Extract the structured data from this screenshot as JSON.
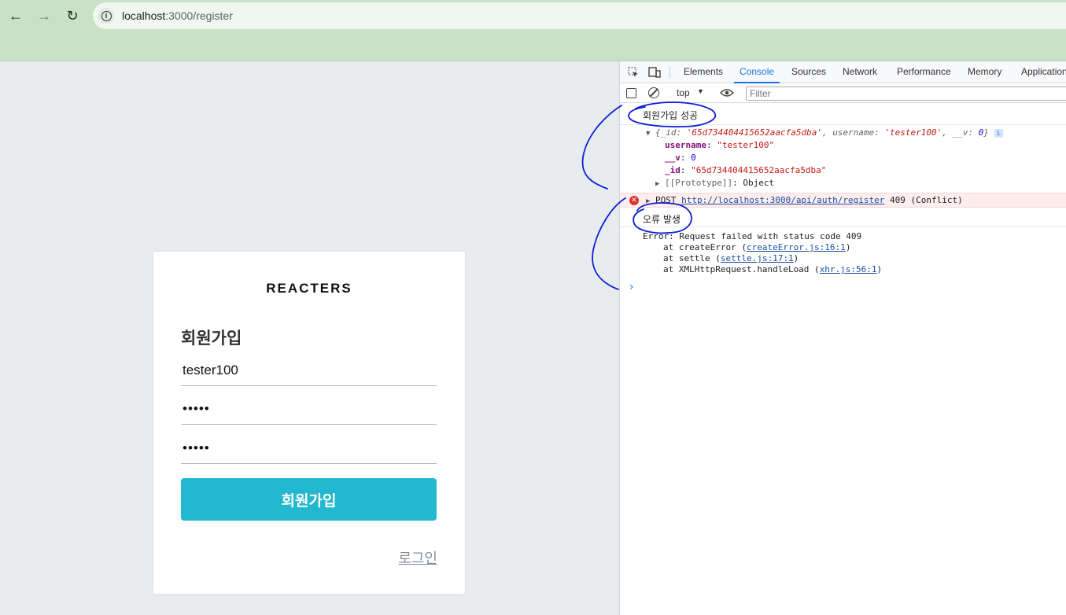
{
  "browser": {
    "url_host": "localhost",
    "url_path": ":3000/register",
    "icons": {
      "back": "arrow-left-icon",
      "forward": "arrow-right-icon",
      "reload": "reload-icon",
      "site_info": "info-icon"
    }
  },
  "page": {
    "brand": "REACTERS",
    "form_title": "회원가입",
    "username_value": "tester100",
    "password_value": "•••••",
    "password_confirm_value": "•••••",
    "submit_label": "회원가입",
    "login_link": "로그인",
    "colors": {
      "accent": "#22b8cf",
      "background": "#e9ecef"
    }
  },
  "devtools": {
    "tabs": [
      "Elements",
      "Console",
      "Sources",
      "Network",
      "Performance",
      "Memory",
      "Application"
    ],
    "active_tab": "Console",
    "context": "top",
    "filter_placeholder": "Filter",
    "console": {
      "log_success": "회원가입 성공",
      "object_summary": {
        "open": "{",
        "id_key": "_id: ",
        "id_value": "'65d734404415652aacfa5dba'",
        "username_key": "username: ",
        "username_value": "'tester100'",
        "v_key": "__v: ",
        "v_value": "0",
        "close": "}"
      },
      "props": {
        "username_key": "username",
        "username_value": "\"tester100\"",
        "v_key": "__v",
        "v_value": "0",
        "id_key": "_id",
        "id_value": "\"65d734404415652aacfa5dba\"",
        "proto_key": "[[Prototype]]",
        "proto_value": "Object"
      },
      "error_request": {
        "method": "POST",
        "url": "http://localhost:3000/api/auth/register",
        "status": "409 (Conflict)"
      },
      "log_error": "오류 발생",
      "trace": {
        "message": "Error: Request failed with status code 409",
        "line1_prefix": "at createError (",
        "line1_link": "createError.js:16:1",
        "line2_prefix": "at settle (",
        "line2_link": "settle.js:17:1",
        "line3_prefix": "at XMLHttpRequest.handleLoad (",
        "line3_link": "xhr.js:56:1",
        "close": ")"
      },
      "prompt": "›"
    }
  }
}
